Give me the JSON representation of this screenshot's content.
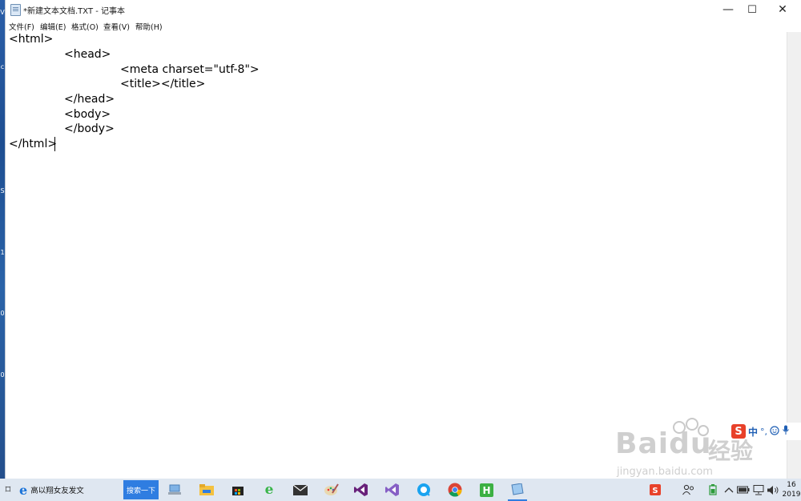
{
  "window": {
    "title": "*新建文本文档.TXT - 记事本",
    "minimize_glyph": "—",
    "maximize_glyph": "☐",
    "close_glyph": "✕"
  },
  "menu": {
    "items": [
      "文件(F)",
      "编辑(E)",
      "格式(O)",
      "查看(V)",
      "帮助(H)"
    ]
  },
  "editor": {
    "lines": [
      "<html>",
      "<head>",
      "<meta charset=\"utf-8\">",
      "<title></title>",
      "</head>",
      "<body>",
      "</body>",
      "</html>"
    ]
  },
  "taskbar": {
    "task_view_glyph": "⌑",
    "browser_label": "高以翔女友发文",
    "search_button": "搜索一下",
    "clock_time": "16",
    "clock_date": "2019"
  },
  "ime": {
    "logo": "S",
    "mode": "中",
    "punct": "°,"
  },
  "watermark": {
    "brand": "Baidu",
    "cn": "经验",
    "url": "jingyan.baidu.com"
  },
  "colors": {
    "taskbar_bg": "#dfe7f1",
    "search_button_bg": "#2f7de1",
    "ime_red": "#e8412a"
  }
}
